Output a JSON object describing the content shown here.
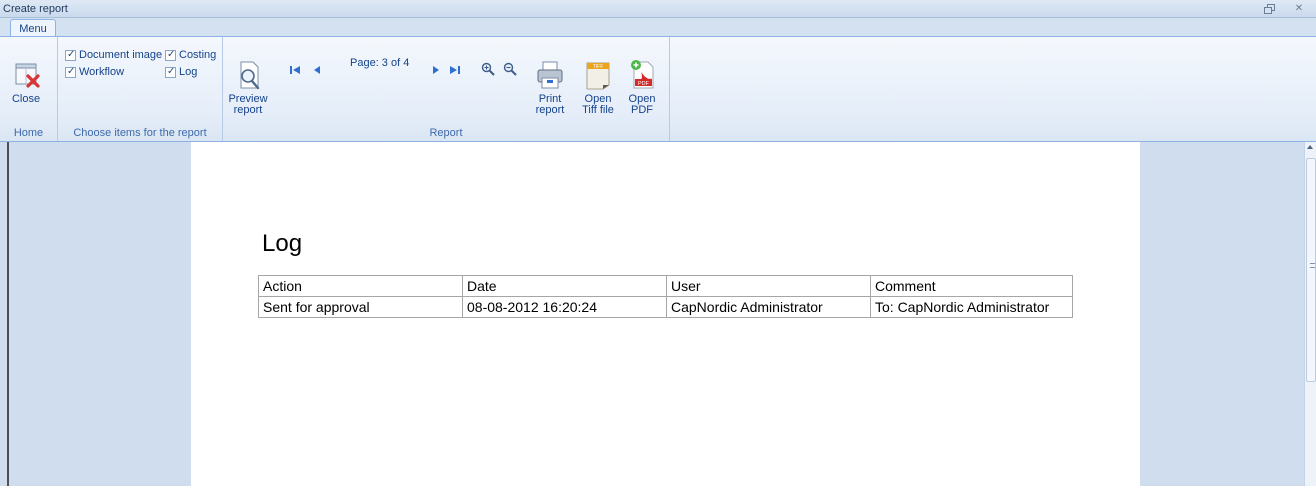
{
  "window": {
    "title": "Create report"
  },
  "tabs": [
    {
      "label": "Menu"
    }
  ],
  "ribbon": {
    "groups": {
      "home": {
        "label": "Home",
        "close_label": "Close"
      },
      "choose": {
        "label": "Choose items for the report",
        "checkboxes": [
          {
            "label": "Document image",
            "checked": true
          },
          {
            "label": "Costing",
            "checked": true
          },
          {
            "label": "Workflow",
            "checked": true
          },
          {
            "label": "Log",
            "checked": true
          }
        ]
      },
      "report": {
        "label": "Report",
        "preview_label_1": "Preview",
        "preview_label_2": "report",
        "page_indicator": "Page: 3 of 4",
        "print_label_1": "Print",
        "print_label_2": "report",
        "tiff_label_1": "Open",
        "tiff_label_2": "Tiff file",
        "pdf_label_1": "Open",
        "pdf_label_2": "PDF",
        "tiff_badge": "TIFF",
        "pdf_badge": "PDF"
      }
    }
  },
  "report_page": {
    "title": "Log",
    "table": {
      "headers": [
        "Action",
        "Date",
        "User",
        "Comment"
      ],
      "rows": [
        [
          "Sent for approval",
          "08-08-2012 16:20:24",
          "CapNordic Administrator",
          "To: CapNordic Administrator"
        ]
      ]
    }
  },
  "colors": {
    "ribbon_text": "#15428b",
    "group_label": "#3e6aaa",
    "content_bg": "#cfddee",
    "close_x": "#d93434",
    "nav_arrow": "#2f6fd1",
    "pdf_red": "#d42a2a"
  },
  "icons": {
    "close": "close-x-icon",
    "preview": "magnifier-page-icon",
    "first": "first-page-icon",
    "prev": "previous-page-icon",
    "next": "next-page-icon",
    "last": "last-page-icon",
    "zoom_in": "zoom-in-icon",
    "zoom_out": "zoom-out-icon",
    "print": "printer-icon",
    "tiff": "tiff-file-icon",
    "pdf": "pdf-file-icon"
  }
}
